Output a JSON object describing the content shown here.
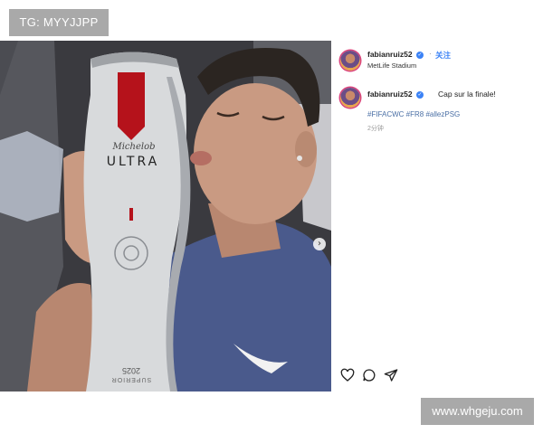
{
  "watermark_top": "TG: MYYJJPP",
  "watermark_bottom": "www.whgeju.com",
  "post": {
    "username": "fabianruiz52",
    "follow_label": "关注",
    "location": "MetLife Stadium",
    "caption": "Cap sur la finale!",
    "hashtags": "#FIFACWC #FR8 #allezPSG",
    "timestamp": "2分钟",
    "verified_icon": "verified-badge-icon",
    "actions": [
      "heart-icon",
      "comment-icon",
      "share-icon"
    ]
  },
  "photo": {
    "can_label_script": "Michelob",
    "can_label": "ULTRA",
    "trophy_year": "2025",
    "trophy_text": "SUPERIOR",
    "colors": {
      "background": "#3a3a3f",
      "shirt": "#4a5a8c",
      "skin": "#c99a82",
      "hair": "#2b2521",
      "can": "#d8dadc",
      "label_red": "#b5121b"
    }
  },
  "colors": {
    "link_blue": "#3b82f6",
    "hashtag": "#4a6fa5",
    "watermark_bg": "#a9a9a9"
  }
}
